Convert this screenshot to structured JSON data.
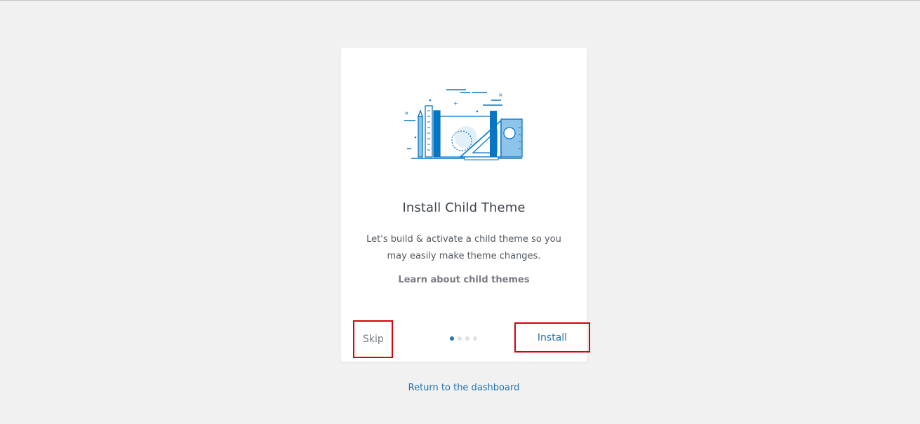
{
  "card": {
    "title": "Install Child Theme",
    "description": "Let's build & activate a child theme so you may easily make theme changes.",
    "learn_link": "Learn about child themes",
    "skip_label": "Skip",
    "install_label": "Install",
    "steps_total": 4,
    "steps_current": 1
  },
  "footer": {
    "return_link": "Return to the dashboard"
  },
  "colors": {
    "accent": "#2271b1",
    "highlight_box": "#d9000d",
    "background": "#f1f1f1"
  },
  "icons": {
    "illustration": "design-tools-illustration"
  }
}
